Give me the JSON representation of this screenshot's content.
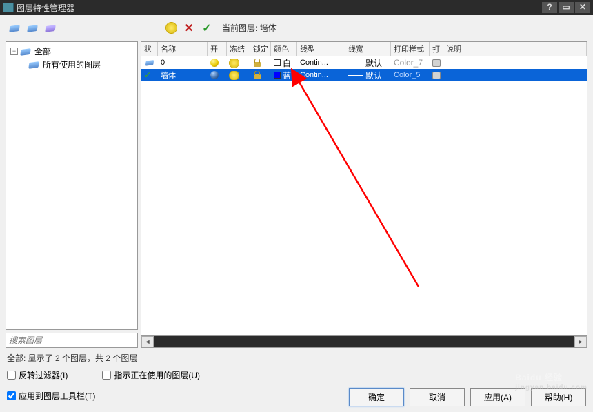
{
  "window": {
    "title": "图层特性管理器"
  },
  "toolbar": {
    "current_layer_label": "当前图层:",
    "current_layer_value": "墙体"
  },
  "tree": {
    "root_label": "全部",
    "child_label": "所有使用的图层",
    "search_placeholder": "搜索图层"
  },
  "columns": {
    "status": "状",
    "name": "名称",
    "on": "开",
    "freeze": "冻结",
    "lock": "锁定",
    "color": "颜色",
    "ltype": "线型",
    "lweight": "线宽",
    "pstyle": "打印样式",
    "plot": "打",
    "desc": "说明"
  },
  "rows": [
    {
      "name": "0",
      "on": true,
      "color_label": "白",
      "color_swatch": "white",
      "ltype": "Contin...",
      "lweight": "默认",
      "pstyle": "Color_7",
      "selected": false,
      "current": false
    },
    {
      "name": "墙体",
      "on": true,
      "color_label": "蓝",
      "color_swatch": "blue",
      "ltype": "Contin...",
      "lweight": "默认",
      "pstyle": "Color_5",
      "selected": true,
      "current": true
    }
  ],
  "footer": {
    "status": "全部: 显示了 2 个图层，共 2 个图层",
    "invert_filter": "反转过滤器(I)",
    "indicate_in_use": "指示正在使用的图层(U)",
    "apply_toolbar": "应用到图层工具栏(T)",
    "ok": "确定",
    "cancel": "取消",
    "apply": "应用(A)",
    "help": "帮助(H)"
  },
  "watermark": {
    "brand": "Baidu 经验",
    "url": "jingyan.baidu.com"
  }
}
